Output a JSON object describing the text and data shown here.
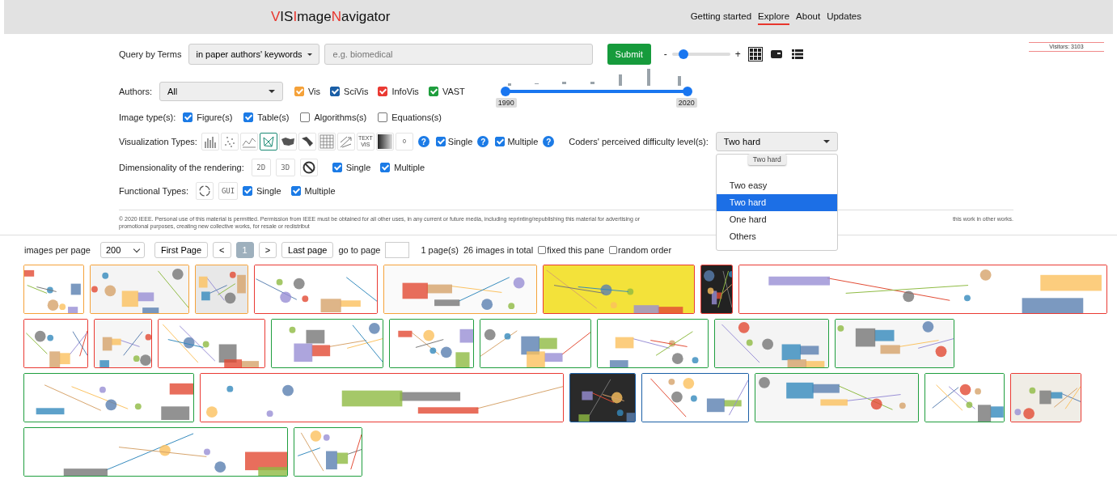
{
  "header": {
    "logo": [
      {
        "text": "V",
        "accent": true
      },
      {
        "text": "IS",
        "accent": false
      },
      {
        "text": "I",
        "accent": true
      },
      {
        "text": "mage",
        "accent": false
      },
      {
        "text": "N",
        "accent": true
      },
      {
        "text": "avigator",
        "accent": false
      }
    ],
    "nav": [
      {
        "label": "Getting started",
        "selected": false
      },
      {
        "label": "Explore",
        "selected": true
      },
      {
        "label": "About",
        "selected": false
      },
      {
        "label": "Updates",
        "selected": false
      }
    ]
  },
  "query": {
    "label": "Query by Terms",
    "scope": "in paper authors' keywords",
    "placeholder": "e.g. biomedical",
    "submit": "Submit"
  },
  "zoom": {
    "minus": "-",
    "plus": "+",
    "level": 0.2
  },
  "views": [
    {
      "kind": "grid",
      "selected": true
    },
    {
      "kind": "card",
      "selected": false
    },
    {
      "kind": "list",
      "selected": false
    }
  ],
  "visitors": "Visitors: 3103",
  "authors": {
    "label": "Authors:",
    "value": "All",
    "conferences": [
      {
        "label": "Vis",
        "checked": true,
        "color": "#f5a23a"
      },
      {
        "label": "SciVis",
        "checked": true,
        "color": "#1b5fa6"
      },
      {
        "label": "InfoVis",
        "checked": true,
        "color": "#ea3a33"
      },
      {
        "label": "VAST",
        "checked": true,
        "color": "#1f9e3e"
      }
    ]
  },
  "year_slider": {
    "handles": [
      {
        "label": "1990",
        "level": 0
      },
      {
        "label": "2020",
        "level": 1
      }
    ]
  },
  "image_types": {
    "label": "Image type(s):",
    "options": [
      {
        "label": "Figure(s)",
        "checked": true
      },
      {
        "label": "Table(s)",
        "checked": true
      },
      {
        "label": "Algorithms(s)",
        "checked": false
      },
      {
        "label": "Equations(s)",
        "checked": false
      }
    ]
  },
  "viz": {
    "label": "Visualization Types:",
    "types": [
      {
        "kind": "bar",
        "selected": false
      },
      {
        "kind": "scatter",
        "selected": false
      },
      {
        "kind": "line",
        "selected": false
      },
      {
        "kind": "network",
        "selected": true
      },
      {
        "kind": "map",
        "selected": false
      },
      {
        "kind": "ribbon",
        "selected": false
      },
      {
        "kind": "grid",
        "selected": false
      },
      {
        "kind": "arrows",
        "selected": false
      },
      {
        "kind": "text",
        "label": "TEXT VIS",
        "selected": false
      },
      {
        "kind": "gradient",
        "selected": false
      },
      {
        "kind": "text",
        "label": "0",
        "selected": false
      }
    ],
    "help": "?",
    "single": {
      "label": "Single",
      "checked": true,
      "help": "?"
    },
    "multiple": {
      "label": "Multiple",
      "checked": true,
      "help": "?"
    }
  },
  "difficulty": {
    "label": "Coders' perceived difficulty level(s):",
    "value": "Two hard",
    "tooltip": "Two hard",
    "options": [
      {
        "label": "Two easy",
        "selected": false
      },
      {
        "label": "Two hard",
        "selected": true
      },
      {
        "label": "One hard",
        "selected": false
      },
      {
        "label": "Others",
        "selected": false
      }
    ]
  },
  "dimensionality": {
    "label": "Dimensionality of the rendering:",
    "types": [
      {
        "kind": "text",
        "label": "2D"
      },
      {
        "kind": "text",
        "label": "3D"
      },
      {
        "kind": "none"
      }
    ],
    "single": {
      "label": "Single",
      "checked": true
    },
    "multiple": {
      "label": "Multiple",
      "checked": true
    }
  },
  "functional": {
    "label": "Functional Types:",
    "types": [
      {
        "kind": "cycle"
      },
      {
        "kind": "text",
        "label": "GUI"
      }
    ],
    "single": {
      "label": "Single",
      "checked": true
    },
    "multiple": {
      "label": "Multiple",
      "checked": true
    }
  },
  "copyright": [
    "© 2020 IEEE. Personal use of this material is permitted. Permission from IEEE must be obtained for all other uses, in any current or future media, including reprinting/republishing this material for advertising or promotional purposes, creating new collective works, for resale or redistribut",
    "this work in other works."
  ],
  "pagination": {
    "per_page_label": "images per page",
    "per_page": "200",
    "first": "First Page",
    "prev": "<",
    "pages": [
      {
        "label": "1",
        "selected": true
      }
    ],
    "next": ">",
    "last": "Last page",
    "goto": "go to page",
    "page_count": "1 page(s)",
    "total": "26 images in total",
    "options": [
      {
        "label": "fixed this pane",
        "checked": false
      },
      {
        "label": "random order",
        "checked": false
      }
    ]
  },
  "thumbnails": [
    {
      "color": "#f5a23a"
    },
    {
      "color": "#f5a23a"
    },
    {
      "color": "#f5a23a"
    },
    {
      "color": "#ea3a33"
    },
    {
      "color": "#f5a23a"
    },
    {
      "color": "#ea3a33"
    },
    {
      "color": "#ea3a33"
    },
    {
      "color": "#ea3a33"
    },
    {
      "color": "#ea3a33"
    },
    {
      "color": "#ea3a33"
    },
    {
      "color": "#ea3a33"
    },
    {
      "color": "#1f9e3e"
    },
    {
      "color": "#1f9e3e"
    },
    {
      "color": "#1f9e3e"
    },
    {
      "color": "#1f9e3e"
    },
    {
      "color": "#1f9e3e"
    },
    {
      "color": "#1f9e3e"
    },
    {
      "color": "#1f9e3e"
    },
    {
      "color": "#ea3a33"
    },
    {
      "color": "#1b5fa6"
    },
    {
      "color": "#1b5fa6"
    },
    {
      "color": "#1f9e3e"
    },
    {
      "color": "#1f9e3e"
    },
    {
      "color": "#ea3a33"
    },
    {
      "color": "#1f9e3e"
    },
    {
      "color": "#1f9e3e"
    }
  ]
}
